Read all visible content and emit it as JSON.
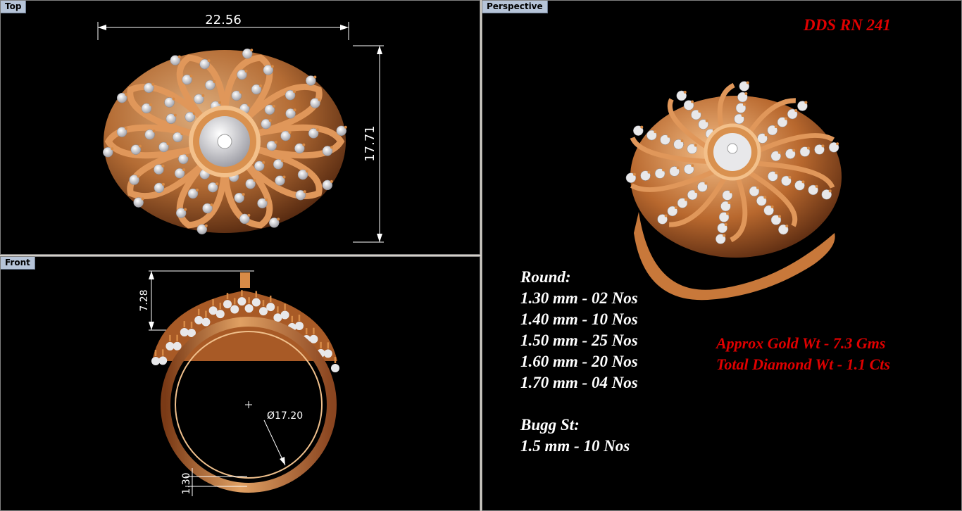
{
  "viewports": {
    "top": {
      "label": "Top",
      "width_dim": "22.56",
      "height_dim": "17.71"
    },
    "front": {
      "label": "Front",
      "height_dim": "7.28",
      "diameter_dim": "Ø17.20",
      "band_dim": "1.30"
    },
    "perspective": {
      "label": "Perspective",
      "design_code": "DDS RN 241",
      "specs": {
        "round_heading": "Round:",
        "round_lines": [
          "1.30 mm - 02 Nos",
          "1.40 mm - 10 Nos",
          "1.50 mm - 25 Nos",
          "1.60 mm - 20 Nos",
          "1.70 mm - 04 Nos"
        ],
        "bugg_heading": "Bugg St:",
        "bugg_lines": [
          "1.5 mm - 10 Nos"
        ]
      },
      "weights": {
        "gold": "Approx Gold Wt - 7.3 Gms",
        "diamond": "Total Diamond Wt - 1.1 Cts"
      }
    }
  },
  "colors": {
    "gold": "#c8783a",
    "gold_light": "#f0b27a",
    "diamond": "#e8e8ea",
    "accent_red": "#e00000",
    "viewport_bg": "#000000",
    "label_bg": "#b6c4d8"
  }
}
